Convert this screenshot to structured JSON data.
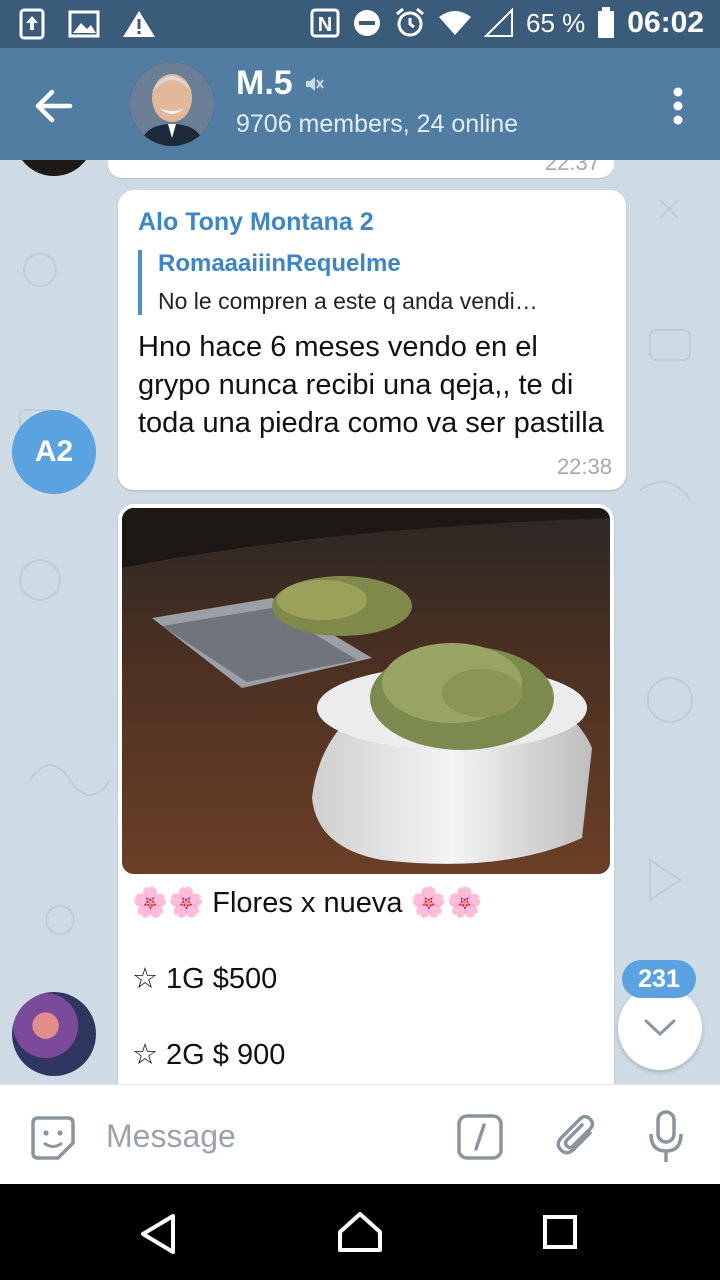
{
  "status_bar": {
    "battery_percent": "65 %",
    "time": "06:02"
  },
  "header": {
    "title": "M.5",
    "subtitle": "9706 members, 24 online"
  },
  "messages": [
    {
      "sender": "Alo Tony Montana 2",
      "avatar_initials": "A2",
      "reply_to_name": "RomaaaiiinRequelme",
      "reply_to_text": "No le compren a este q anda vendi…",
      "text": "Hno hace 6 meses vendo en el grypo nunca recibi una qeja,, te di toda una piedra como va ser pastilla",
      "time": "22:38"
    },
    {
      "caption_lines": [
        "🌸🌸 Flores x nueva 🌸🌸",
        "☆ 1G $500",
        "☆ 2G $ 900"
      ]
    }
  ],
  "previous_message_time": "22:37",
  "unread_count": "231",
  "composer": {
    "placeholder": "Message"
  },
  "colors": {
    "status_bar": "#3a5b7a",
    "app_bar": "#517da2",
    "chat_background": "#cfdbe4",
    "accent": "#3d85c4",
    "badge": "#5aa3e0"
  }
}
